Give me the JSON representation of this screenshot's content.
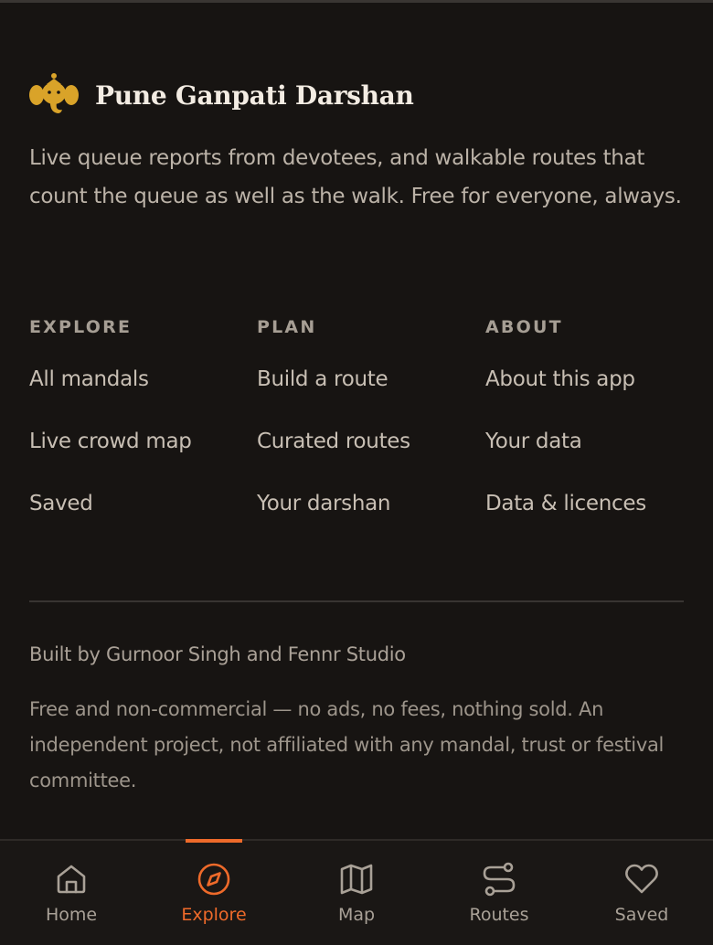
{
  "app": {
    "title": "Pune Ganpati Darshan",
    "logo_icon": "ganesha-icon",
    "tagline": "Live queue reports from devotees, and walkable routes that count the queue as well as the walk. Free for everyone, always."
  },
  "footer_columns": [
    {
      "heading": "EXPLORE",
      "links": [
        "All mandals",
        "Live crowd map",
        "Saved"
      ]
    },
    {
      "heading": "PLAN",
      "links": [
        "Build a route",
        "Curated routes",
        "Your darshan"
      ]
    },
    {
      "heading": "ABOUT",
      "links": [
        "About this app",
        "Your data",
        "Data & licences"
      ]
    }
  ],
  "credits": {
    "built_by": "Built by Gurnoor Singh and Fennr Studio",
    "disclaimer": "Free and non-commercial — no ads, no fees, nothing sold. An independent project, not affiliated with any mandal, trust or festival committee."
  },
  "bottom_nav": {
    "active": "Explore",
    "items": [
      {
        "label": "Home",
        "icon": "home-icon"
      },
      {
        "label": "Explore",
        "icon": "compass-icon"
      },
      {
        "label": "Map",
        "icon": "map-icon"
      },
      {
        "label": "Routes",
        "icon": "routes-icon"
      },
      {
        "label": "Saved",
        "icon": "heart-icon"
      }
    ]
  },
  "colors": {
    "background": "#171412",
    "accent": "#ee6a2a",
    "logo_gold": "#d9a329",
    "title": "#f3ece3"
  }
}
